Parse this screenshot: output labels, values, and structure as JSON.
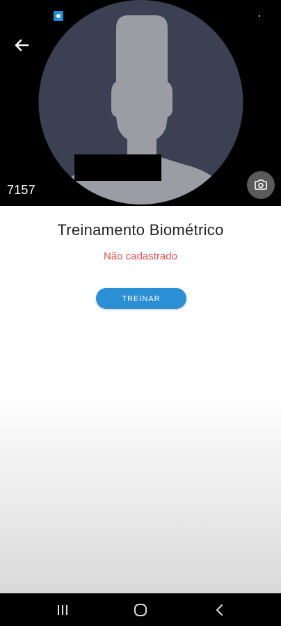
{
  "header": {
    "user_id": "7157",
    "back_icon": "arrow-left-icon",
    "camera_icon": "camera-icon"
  },
  "content": {
    "title": "Treinamento Biométrico",
    "status": "Não cadastrado",
    "train_button": "TREINAR"
  },
  "colors": {
    "status": "#e05252",
    "button": "#2b8fd6",
    "avatar_bg": "#3b4153",
    "avatar_silhouette": "#9a9ea4"
  },
  "navbar": {
    "recents_icon": "recents-icon",
    "home_icon": "home-icon",
    "back_icon": "chevron-left-icon"
  }
}
